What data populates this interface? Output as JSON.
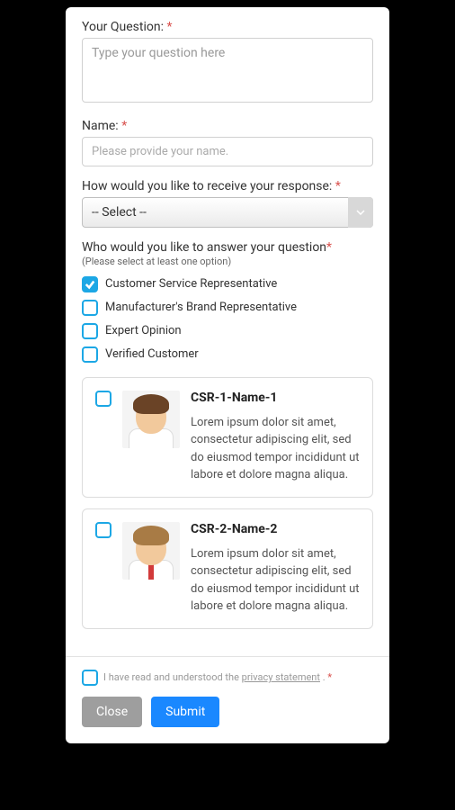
{
  "form": {
    "question_label": "Your Question:",
    "question_placeholder": "Type your question here",
    "name_label": "Name:",
    "name_placeholder": "Please provide your name.",
    "response_label": "How would you like to receive your response:",
    "select_placeholder": "-- Select --",
    "answer_by_label": "Who would you like to answer your question",
    "answer_by_note": "(Please select at least one option)",
    "options": [
      {
        "label": "Customer Service Representative",
        "checked": true
      },
      {
        "label": "Manufacturer's Brand Representative",
        "checked": false
      },
      {
        "label": "Expert Opinion",
        "checked": false
      },
      {
        "label": "Verified Customer",
        "checked": false
      }
    ]
  },
  "cards": [
    {
      "name": "CSR-1-Name-1",
      "desc": "Lorem ipsum dolor sit amet, consectetur adipiscing elit, sed do eiusmod tempor incididunt ut labore et dolore magna aliqua."
    },
    {
      "name": "CSR-2-Name-2",
      "desc": "Lorem ipsum dolor sit amet, consectetur adipiscing elit, sed do eiusmod tempor incididunt ut labore et dolore magna aliqua."
    }
  ],
  "footer": {
    "privacy_prefix": "I have read and understood the ",
    "privacy_link": "privacy statement",
    "privacy_suffix": " .",
    "close": "Close",
    "submit": "Submit"
  },
  "icons": {
    "required": "*"
  }
}
